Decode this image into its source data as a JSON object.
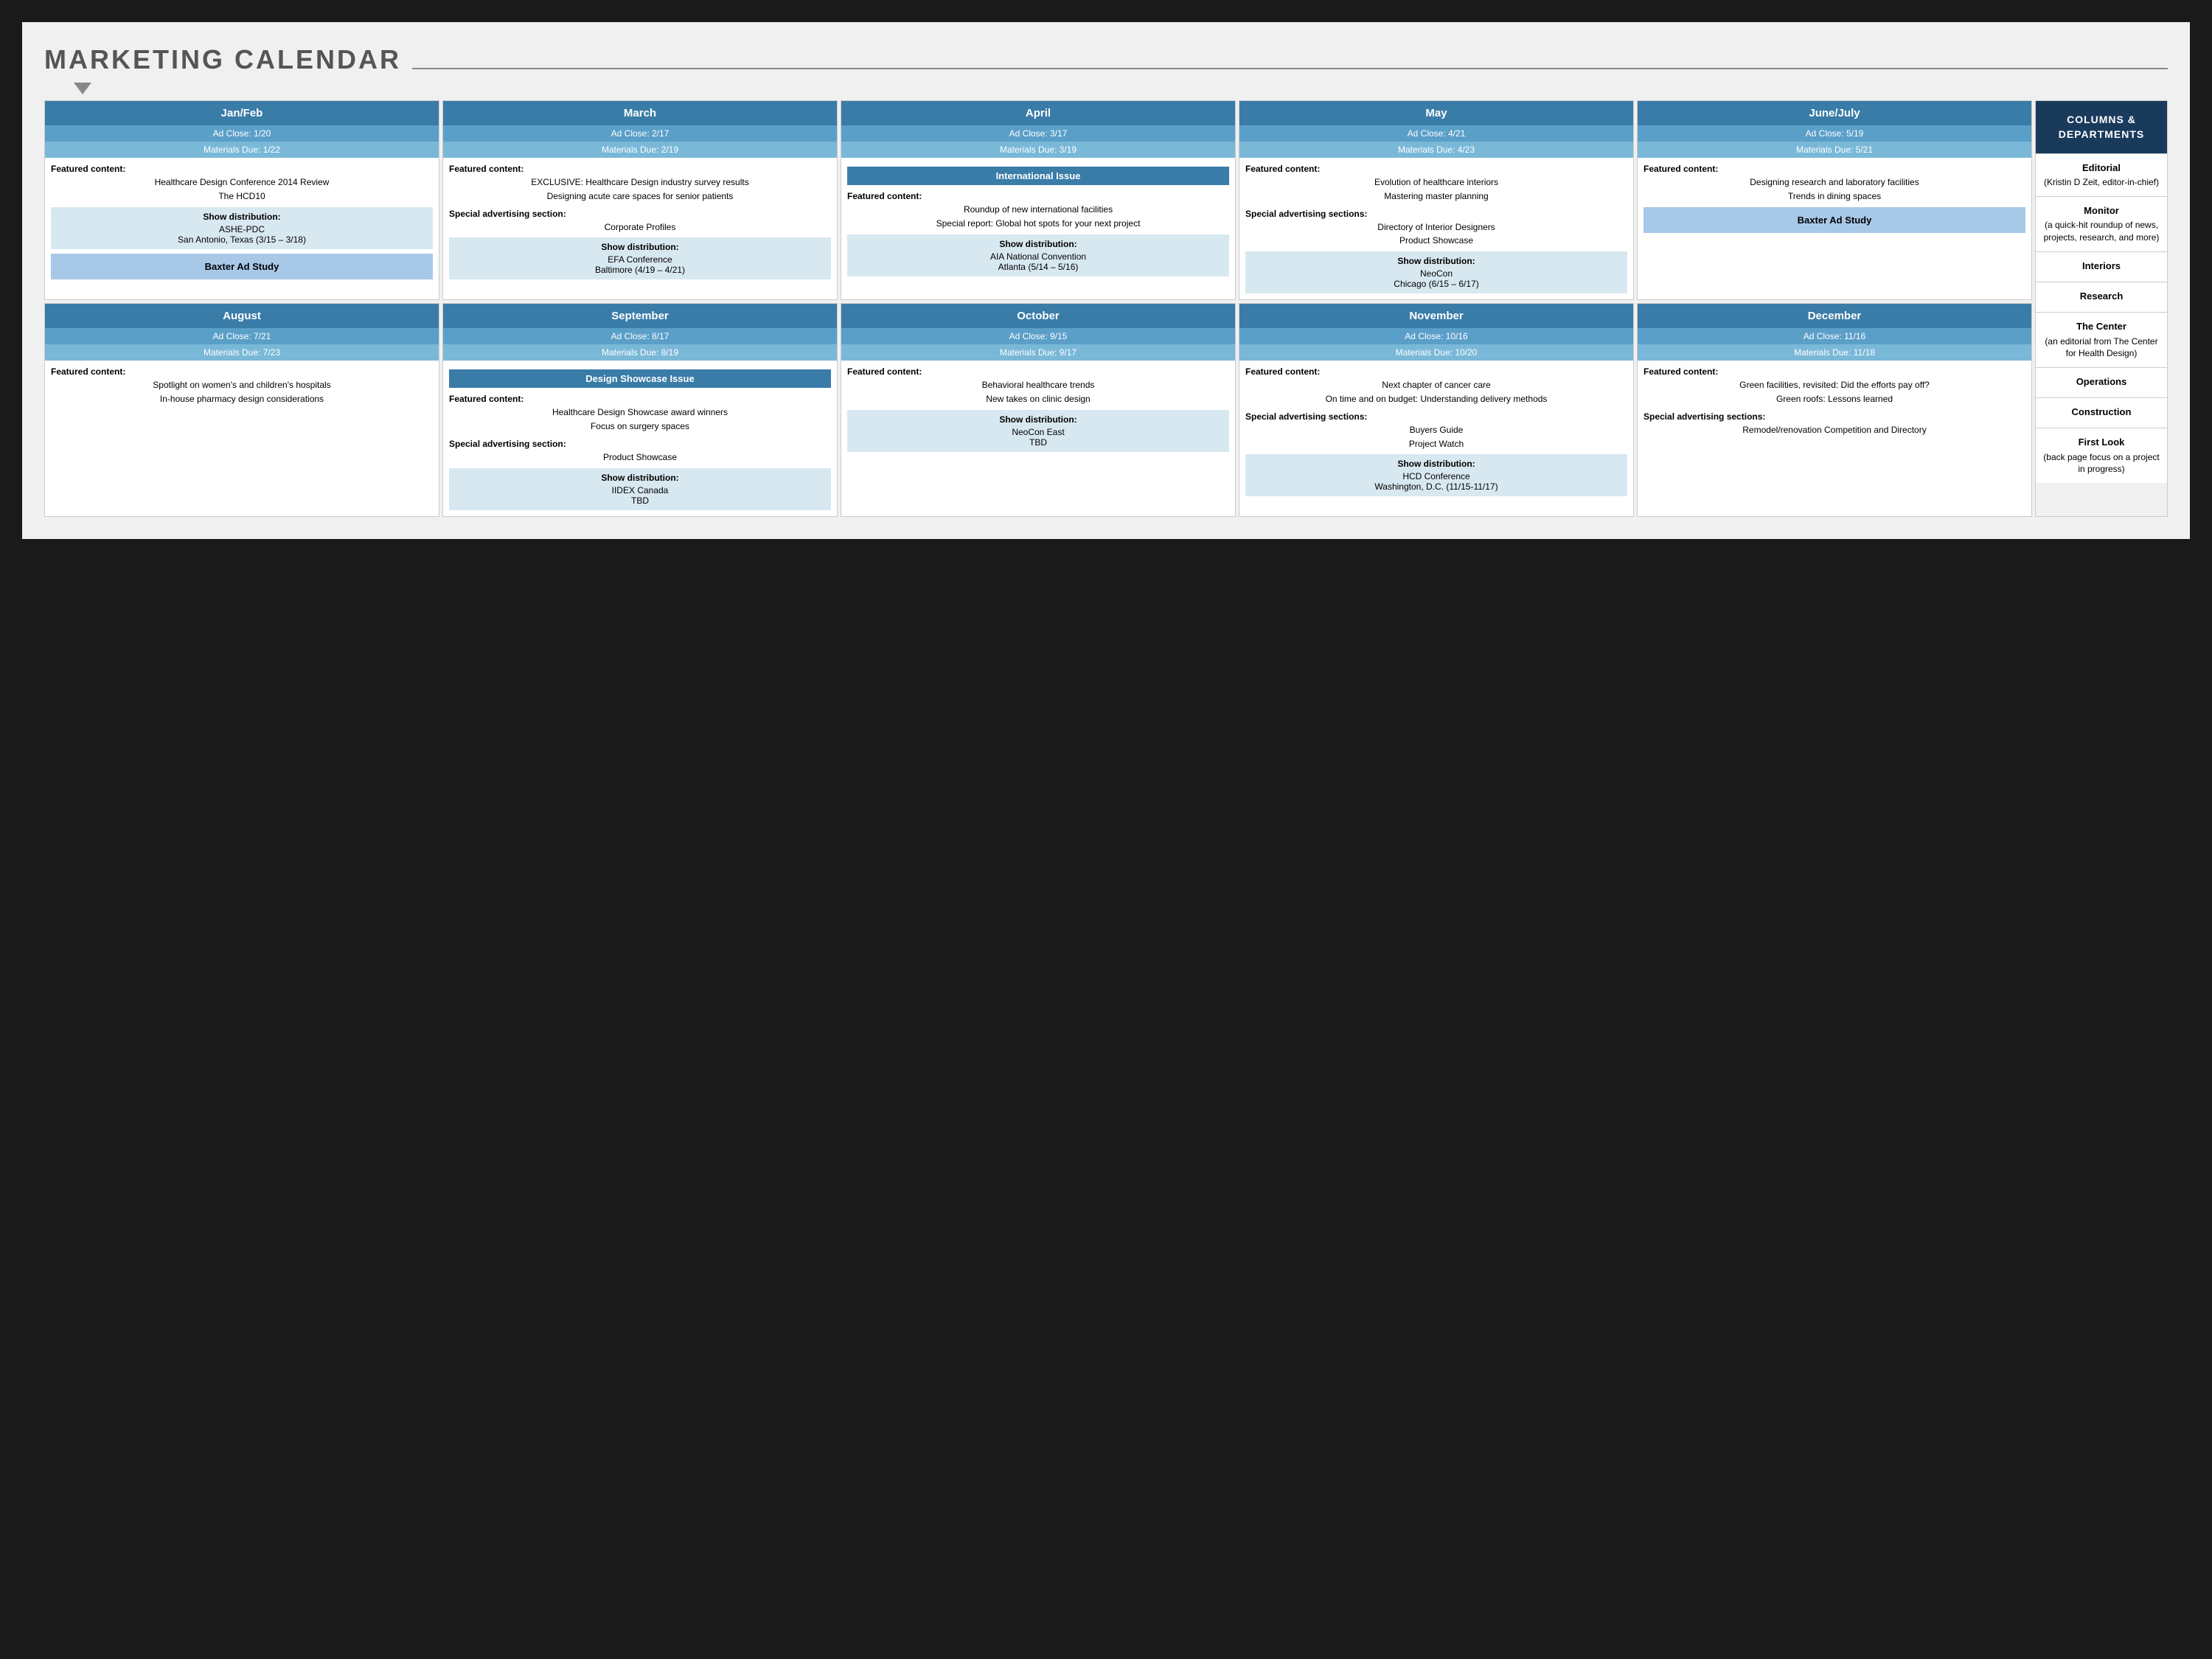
{
  "title": "MARKETING CALENDAR",
  "top_row": [
    {
      "id": "jan_feb",
      "month": "Jan/Feb",
      "ad_close": "Ad Close: 1/20",
      "materials": "Materials Due: 1/22",
      "featured_label": "Featured content:",
      "featured_items": [
        "Healthcare Design Conference 2014 Review",
        "The HCD10"
      ],
      "show_dist_label": "Show distribution:",
      "show_dist_items": [
        "ASHE-PDC",
        "San Antonio, Texas (3/15 – 3/18)"
      ],
      "special_label": "",
      "special_items": [],
      "baxter": "Baxter Ad Study"
    },
    {
      "id": "march",
      "month": "March",
      "ad_close": "Ad Close: 2/17",
      "materials": "Materials Due: 2/19",
      "featured_label": "Featured content:",
      "featured_items": [
        "EXCLUSIVE: Healthcare Design industry survey results",
        "Designing acute care spaces for senior patients"
      ],
      "special_label": "Special advertising section:",
      "special_items": [
        "Corporate Profiles"
      ],
      "show_dist_label": "Show distribution:",
      "show_dist_items": [
        "EFA Conference",
        "Baltimore (4/19 – 4/21)"
      ]
    },
    {
      "id": "april",
      "month": "April",
      "ad_close": "Ad Close: 3/17",
      "materials": "Materials Due: 3/19",
      "international": "International Issue",
      "featured_label": "Featured content:",
      "featured_items": [
        "Roundup of new international facilities",
        "Special report: Global hot spots for your next project"
      ],
      "show_dist_label": "Show distribution:",
      "show_dist_items": [
        "AIA National Convention",
        "Atlanta (5/14 – 5/16)"
      ]
    },
    {
      "id": "may",
      "month": "May",
      "ad_close": "Ad Close: 4/21",
      "materials": "Materials Due: 4/23",
      "featured_label": "Featured content:",
      "featured_items": [
        "Evolution of healthcare interiors",
        "Mastering master planning"
      ],
      "special_label": "Special advertising sections:",
      "special_items": [
        "Directory of Interior Designers",
        "Product Showcase"
      ],
      "show_dist_label": "Show distribution:",
      "show_dist_items": [
        "NeoCon",
        "Chicago (6/15 – 6/17)"
      ]
    },
    {
      "id": "june_july",
      "month": "June/July",
      "ad_close": "Ad Close: 5/19",
      "materials": "Materials Due: 5/21",
      "featured_label": "Featured content:",
      "featured_items": [
        "Designing research and laboratory facilities",
        "Trends in dining spaces"
      ],
      "baxter": "Baxter Ad Study"
    }
  ],
  "bottom_row": [
    {
      "id": "august",
      "month": "August",
      "ad_close": "Ad Close: 7/21",
      "materials": "Materials Due: 7/23",
      "featured_label": "Featured content:",
      "featured_items": [
        "Spotlight on women's and children's hospitals",
        "In-house pharmacy design considerations"
      ]
    },
    {
      "id": "september",
      "month": "September",
      "ad_close": "Ad Close: 8/17",
      "materials": "Materials Due: 8/19",
      "design_showcase": "Design Showcase Issue",
      "featured_label": "Featured content:",
      "featured_items": [
        "Healthcare Design Showcase award winners",
        "Focus on surgery spaces"
      ],
      "special_label": "Special advertising section:",
      "special_items": [
        "Product Showcase"
      ],
      "show_dist_label": "Show distribution:",
      "show_dist_items": [
        "IIDEX Canada",
        "TBD"
      ]
    },
    {
      "id": "october",
      "month": "October",
      "ad_close": "Ad Close: 9/15",
      "materials": "Materials Due: 9/17",
      "featured_label": "Featured content:",
      "featured_items": [
        "Behavioral healthcare trends",
        "New takes on clinic design"
      ],
      "show_dist_label": "Show distribution:",
      "show_dist_items": [
        "NeoCon East",
        "TBD"
      ]
    },
    {
      "id": "november",
      "month": "November",
      "ad_close": "Ad Close: 10/16",
      "materials": "Materials Due: 10/20",
      "featured_label": "Featured content:",
      "featured_items": [
        "Next chapter of cancer care",
        "On time and on budget: Understanding delivery methods"
      ],
      "special_label": "Special advertising sections:",
      "special_items": [
        "Buyers Guide",
        "Project Watch"
      ],
      "show_dist_label": "Show distribution:",
      "show_dist_items": [
        "HCD Conference",
        "Washington, D.C. (11/15-11/17)"
      ]
    },
    {
      "id": "december",
      "month": "December",
      "ad_close": "Ad Close: 11/16",
      "materials": "Materials Due: 11/18",
      "featured_label": "Featured content:",
      "featured_items": [
        "Green facilities, revisited: Did the efforts pay off?",
        "Green roofs: Lessons learned"
      ],
      "special_label": "Special advertising sections:",
      "special_items": [
        "Remodel/renovation Competition and Directory"
      ]
    }
  ],
  "sidebar": {
    "header": "COLUMNS & DEPARTMENTS",
    "items": [
      {
        "label": "Editorial",
        "sub": "(Kristin D Zeit, editor-in-chief)"
      },
      {
        "label": "Monitor",
        "sub": "(a quick-hit roundup of news, projects, research, and more)"
      },
      {
        "label": "Interiors",
        "sub": ""
      },
      {
        "label": "Research",
        "sub": ""
      },
      {
        "label": "The Center",
        "sub": "(an editorial from The Center for Health Design)"
      },
      {
        "label": "Operations",
        "sub": ""
      },
      {
        "label": "Construction",
        "sub": ""
      },
      {
        "label": "First Look",
        "sub": "(back page focus on a project in progress)"
      }
    ]
  }
}
